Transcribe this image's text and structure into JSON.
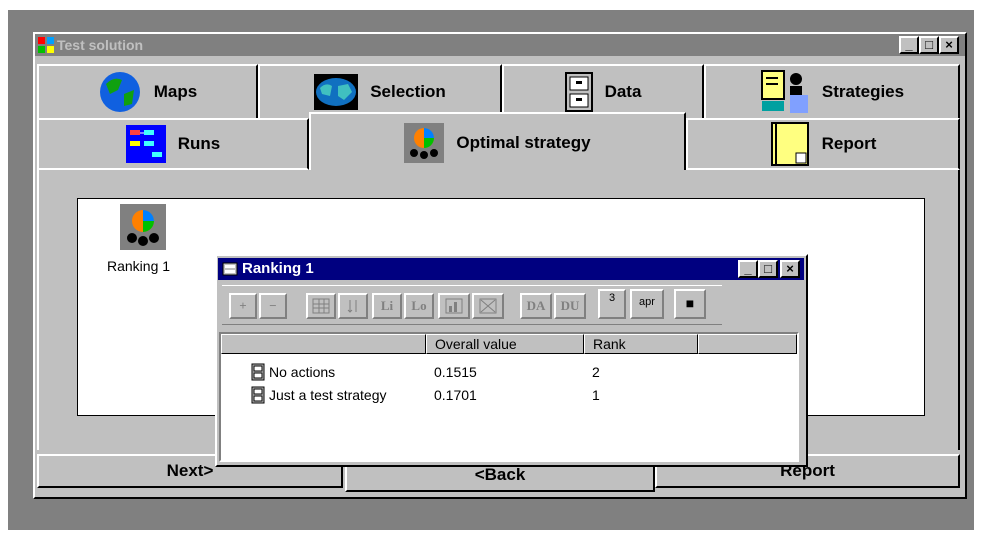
{
  "window": {
    "title": "Test solution",
    "controls": [
      "_",
      "□",
      "×"
    ]
  },
  "tabs_row1": [
    {
      "label": "Maps",
      "icon": "globe-icon"
    },
    {
      "label": "Selection",
      "icon": "world-map-icon"
    },
    {
      "label": "Data",
      "icon": "file-cabinet-icon"
    },
    {
      "label": "Strategies",
      "icon": "person-board-icon"
    }
  ],
  "tabs_row2": [
    {
      "label": "Runs",
      "icon": "flowchart-icon"
    },
    {
      "label": "Optimal strategy",
      "icon": "ranking-pie-icon"
    },
    {
      "label": "Report",
      "icon": "notepad-icon"
    }
  ],
  "desktop_item": {
    "label": "Ranking 1",
    "icon": "ranking-pie-icon"
  },
  "subwindow": {
    "title": "Ranking 1",
    "toolbar": [
      "+",
      "−",
      "",
      "",
      "Li",
      "Lo",
      "",
      "",
      "DA",
      "DU",
      "3",
      "apr",
      "■"
    ],
    "columns": [
      "",
      "Overall value",
      "Rank",
      ""
    ],
    "rows": [
      {
        "name": "No actions",
        "value": "0.1515",
        "rank": "2"
      },
      {
        "name": "Just a test strategy",
        "value": "0.1701",
        "rank": "1"
      }
    ]
  },
  "buttons": {
    "next": "Next>",
    "back": "<Back",
    "report": "Report"
  },
  "colors": {
    "title_active": "#000080",
    "title_inactive": "#808080",
    "face": "#c0c0c0"
  }
}
